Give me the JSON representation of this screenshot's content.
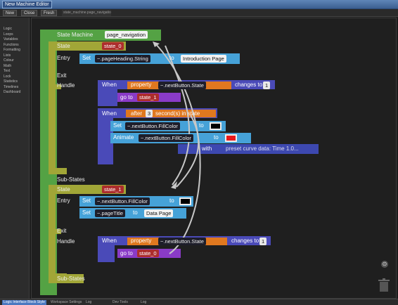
{
  "window": {
    "title": "New Machine Editor"
  },
  "toolbar": {
    "buttons": [
      "New",
      "Close",
      "Fresh"
    ],
    "path": "state_machine.page_navigation.js"
  },
  "sidebar": {
    "items": [
      "Logic",
      "Loops",
      "Variables",
      "Functions",
      "Formatting",
      "Lists",
      "Colour",
      "Math",
      "Text",
      "Lock",
      "Statistics",
      "Timelines",
      "Dashboard"
    ]
  },
  "statusbar": {
    "items": [
      "Logic Interface Block Style",
      "Workspace Settings",
      "Log",
      "Dev Tools",
      "Log"
    ]
  },
  "machine": {
    "header_label": "State Machine",
    "name": "page_navigation",
    "state_label": "State",
    "entry_label": "Entry",
    "exit_label": "Exit",
    "handle_label": "Handle",
    "substates_label": "Sub-States",
    "set_label": "Set",
    "to_label": "to",
    "when_label": "When",
    "goto_label": "go to",
    "with_label": "with",
    "animate_label": "Animate",
    "property_label": "property",
    "changes_to_label": "changes to",
    "after_label": "after",
    "seconds_label": "second(s) in state",
    "state0": {
      "name": "state_0",
      "entry_target": "~.pageHeading.String",
      "entry_value": "Introduction Page",
      "handle1_property": "~.nextButton.State",
      "handle1_value": "1",
      "handle1_goto": "state_1",
      "handle2_seconds": "3",
      "handle2_set_target": "~.nextButton.FillColor",
      "handle2_set_color": "#000000",
      "handle2_anim_target": "~.nextButton.FillColor",
      "handle2_anim_color": "#e8191b",
      "handle2_curve": "preset curve data: Time 1.0..."
    },
    "state1": {
      "name": "state_1",
      "entry1_target": "~.nextButton.FillColor",
      "entry1_color": "#000000",
      "entry2_target": "~.pageTitle",
      "entry2_value": "Data Page",
      "handle_property": "~.nextButton.State",
      "handle_value": "1",
      "handle_goto": "state_0"
    }
  }
}
